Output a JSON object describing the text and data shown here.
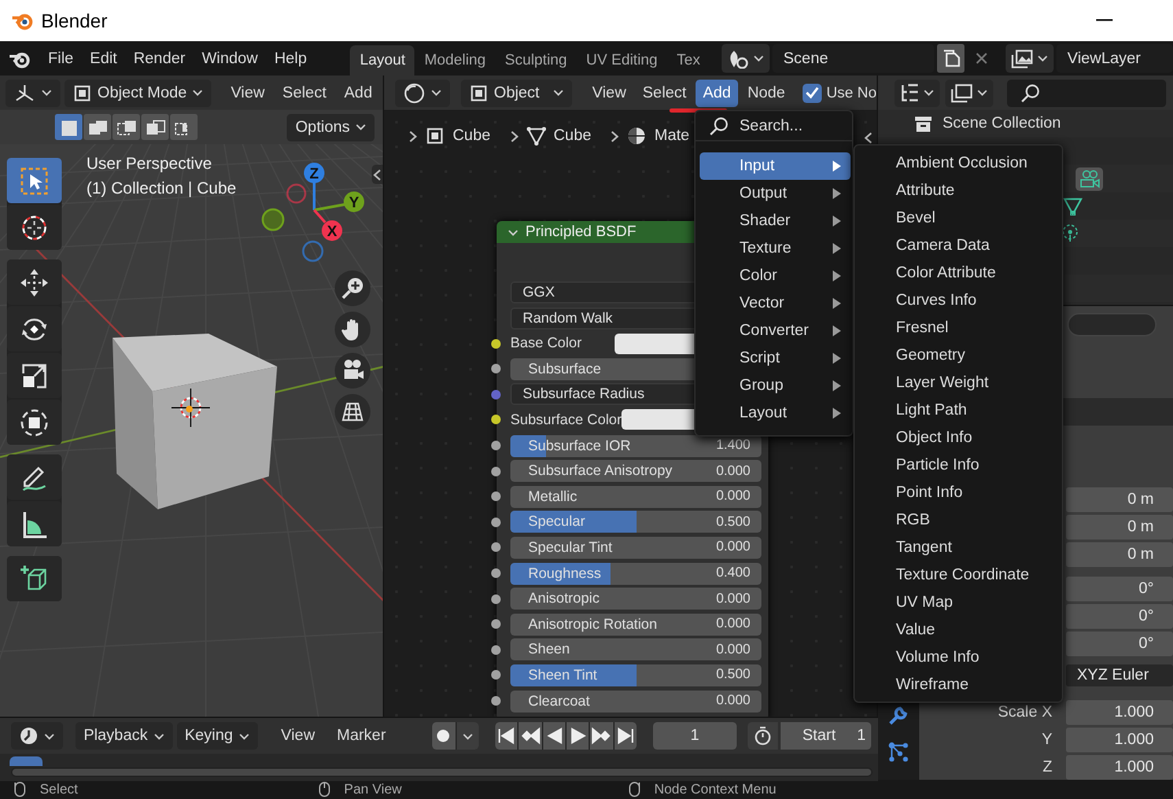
{
  "window": {
    "title": "Blender"
  },
  "top_bar": {
    "menus": [
      "File",
      "Edit",
      "Render",
      "Window",
      "Help"
    ],
    "workspaces": [
      {
        "label": "Layout",
        "selected": true
      },
      {
        "label": "Modeling",
        "selected": false
      },
      {
        "label": "Sculpting",
        "selected": false
      },
      {
        "label": "UV Editing",
        "selected": false
      },
      {
        "label": "Tex",
        "selected": false
      }
    ],
    "scene": "Scene",
    "view_layer": "ViewLayer"
  },
  "viewport": {
    "mode": "Object Mode",
    "menus": [
      "View",
      "Select",
      "Add"
    ],
    "select_modes": [
      {
        "kind": "new",
        "selected": true
      },
      {
        "kind": "extend",
        "selected": false
      },
      {
        "kind": "subtract",
        "selected": false
      },
      {
        "kind": "invert",
        "selected": false
      },
      {
        "kind": "intersect",
        "selected": false
      }
    ],
    "options": "Options",
    "view_name": "User Perspective",
    "view_info": "(1) Collection | Cube",
    "axes": [
      {
        "label": "Z",
        "color": "#2f7fe0"
      },
      {
        "label": "Y",
        "color": "#6ea11c"
      },
      {
        "label": "X",
        "color": "#f0334f"
      }
    ],
    "tool_groups": [
      [
        {
          "kind": "select",
          "selected": true
        },
        {
          "kind": "cursor",
          "selected": false
        }
      ],
      [
        {
          "kind": "move",
          "selected": false
        },
        {
          "kind": "rotate",
          "selected": false
        },
        {
          "kind": "scale",
          "selected": false
        },
        {
          "kind": "transform",
          "selected": false
        }
      ],
      [
        {
          "kind": "annotate",
          "selected": false
        },
        {
          "kind": "measure",
          "selected": false
        }
      ],
      [
        {
          "kind": "add_cube",
          "selected": false
        }
      ]
    ]
  },
  "node_editor": {
    "object": "Object",
    "menus": [
      {
        "label": "View",
        "selected": false
      },
      {
        "label": "Select",
        "selected": false
      },
      {
        "label": "Add",
        "selected": true
      },
      {
        "label": "Node",
        "selected": false
      }
    ],
    "use_nodes": {
      "label": "Use No",
      "checked": true
    },
    "breadcrumbs": [
      "Cube",
      "Cube",
      "Mate"
    ],
    "node": {
      "title": "Principled BSDF",
      "rows": [
        {
          "kind": "dropdown",
          "label": "GGX"
        },
        {
          "kind": "dropdown",
          "label": "Random Walk"
        },
        {
          "kind": "color",
          "label": "Base Color",
          "color": "#c7c729"
        },
        {
          "kind": "slider",
          "label": "Subsurface",
          "color": "#a1a1a1",
          "level": 0
        },
        {
          "kind": "vector",
          "label": "Subsurface Radius",
          "color": "#6363c7"
        },
        {
          "kind": "color",
          "label": "Subsurface Color",
          "color": "#c7c729"
        },
        {
          "kind": "slider",
          "label": "Subsurface IOR",
          "color": "#a1a1a1",
          "level": 0.14,
          "value": "1.400"
        },
        {
          "kind": "slider",
          "label": "Subsurface Anisotropy",
          "color": "#a1a1a1",
          "level": 0,
          "value": "0.000"
        },
        {
          "kind": "slider",
          "label": "Metallic",
          "color": "#a1a1a1",
          "level": 0,
          "value": "0.000"
        },
        {
          "kind": "slider",
          "label": "Specular",
          "color": "#a1a1a1",
          "level": 0.5,
          "value": "0.500"
        },
        {
          "kind": "slider",
          "label": "Specular Tint",
          "color": "#a1a1a1",
          "level": 0,
          "value": "0.000"
        },
        {
          "kind": "slider",
          "label": "Roughness",
          "color": "#a1a1a1",
          "level": 0.4,
          "value": "0.400"
        },
        {
          "kind": "slider",
          "label": "Anisotropic",
          "color": "#a1a1a1",
          "level": 0,
          "value": "0.000"
        },
        {
          "kind": "slider",
          "label": "Anisotropic Rotation",
          "color": "#a1a1a1",
          "level": 0,
          "value": "0.000"
        },
        {
          "kind": "slider",
          "label": "Sheen",
          "color": "#a1a1a1",
          "level": 0,
          "value": "0.000"
        },
        {
          "kind": "slider",
          "label": "Sheen Tint",
          "color": "#a1a1a1",
          "level": 0.5,
          "value": "0.500"
        },
        {
          "kind": "slider",
          "label": "Clearcoat",
          "color": "#a1a1a1",
          "level": 0,
          "value": "0.000"
        }
      ]
    }
  },
  "add_menu": {
    "search": "Search...",
    "items": [
      {
        "label": "Input",
        "selected": true
      },
      {
        "label": "Output",
        "selected": false
      },
      {
        "label": "Shader",
        "selected": false
      },
      {
        "label": "Texture",
        "selected": false
      },
      {
        "label": "Color",
        "selected": false
      },
      {
        "label": "Vector",
        "selected": false
      },
      {
        "label": "Converter",
        "selected": false
      },
      {
        "label": "Script",
        "selected": false
      },
      {
        "label": "Group",
        "selected": false
      },
      {
        "label": "Layout",
        "selected": false
      }
    ],
    "submenu": [
      "Ambient Occlusion",
      "Attribute",
      "Bevel",
      "Camera Data",
      "Color Attribute",
      "Curves Info",
      "Fresnel",
      "Geometry",
      "Layer Weight",
      "Light Path",
      "Object Info",
      "Particle Info",
      "Point Info",
      "RGB",
      "Tangent",
      "Texture Coordinate",
      "UV Map",
      "Value",
      "Volume Info",
      "Wireframe"
    ]
  },
  "outliner": {
    "root": "Scene Collection"
  },
  "properties": {
    "location": [
      "0 m",
      "0 m",
      "0 m"
    ],
    "rotation": [
      "0°",
      "0°",
      "0°"
    ],
    "rotation_mode": "XYZ Euler",
    "scale": [
      {
        "label": "Scale X",
        "value": "1.000"
      },
      {
        "label": "Y",
        "value": "1.000"
      },
      {
        "label": "Z",
        "value": "1.000"
      }
    ]
  },
  "timeline": {
    "menus": [
      {
        "kind": "dropdown",
        "label": "Playback"
      },
      {
        "kind": "dropdown",
        "label": "Keying"
      },
      {
        "kind": "menu",
        "label": "View"
      },
      {
        "kind": "menu",
        "label": "Marker"
      }
    ],
    "current_frame": "1",
    "start_label": "Start",
    "start_value": "1"
  },
  "status_bar": [
    "Select",
    "Pan View",
    "Node Context Menu"
  ]
}
